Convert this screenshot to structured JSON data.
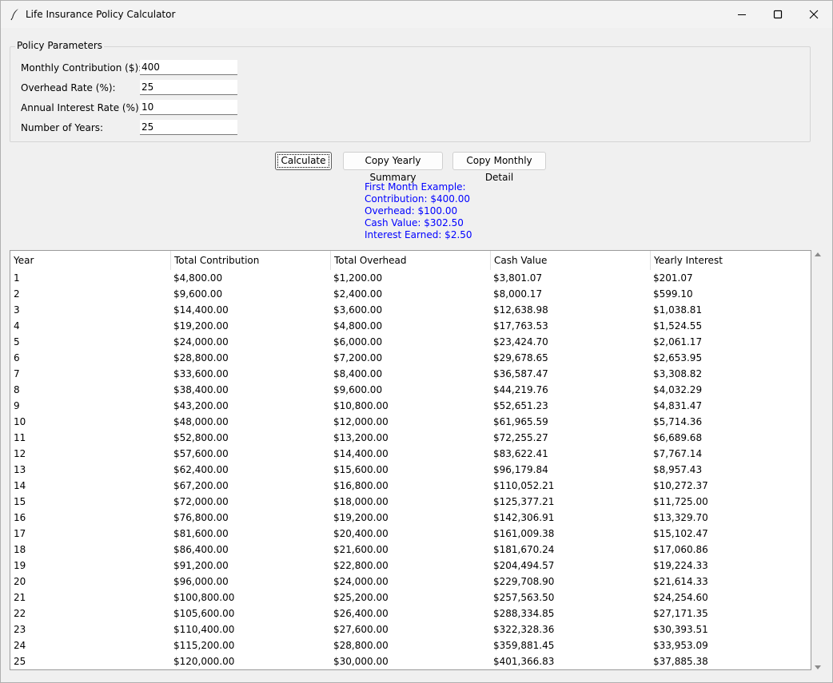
{
  "window": {
    "title": "Life Insurance Policy Calculator",
    "icon": "feather-icon",
    "controls": [
      "minimize-icon",
      "maximize-icon",
      "close-icon"
    ]
  },
  "params": {
    "legend": "Policy Parameters",
    "monthly_contribution": {
      "label": "Monthly Contribution ($):",
      "value": "400"
    },
    "overhead_rate": {
      "label": "Overhead Rate (%):",
      "value": "25"
    },
    "annual_interest_rate": {
      "label": "Annual Interest Rate (%):",
      "value": "10"
    },
    "number_of_years": {
      "label": "Number of Years:",
      "value": "25"
    }
  },
  "buttons": {
    "calculate": "Calculate",
    "copy_yearly": "Copy Yearly Summary",
    "copy_monthly": "Copy Monthly Detail"
  },
  "first_month": {
    "heading": "First Month Example:",
    "contribution": "Contribution: $400.00",
    "overhead": "Overhead: $100.00",
    "cash_value": "Cash Value: $302.50",
    "interest": "Interest Earned: $2.50"
  },
  "colors": {
    "example_text": "#0000ff"
  },
  "table": {
    "columns": [
      "Year",
      "Total Contribution",
      "Total Overhead",
      "Cash Value",
      "Yearly Interest"
    ],
    "rows": [
      [
        "1",
        "$4,800.00",
        "$1,200.00",
        "$3,801.07",
        "$201.07"
      ],
      [
        "2",
        "$9,600.00",
        "$2,400.00",
        "$8,000.17",
        "$599.10"
      ],
      [
        "3",
        "$14,400.00",
        "$3,600.00",
        "$12,638.98",
        "$1,038.81"
      ],
      [
        "4",
        "$19,200.00",
        "$4,800.00",
        "$17,763.53",
        "$1,524.55"
      ],
      [
        "5",
        "$24,000.00",
        "$6,000.00",
        "$23,424.70",
        "$2,061.17"
      ],
      [
        "6",
        "$28,800.00",
        "$7,200.00",
        "$29,678.65",
        "$2,653.95"
      ],
      [
        "7",
        "$33,600.00",
        "$8,400.00",
        "$36,587.47",
        "$3,308.82"
      ],
      [
        "8",
        "$38,400.00",
        "$9,600.00",
        "$44,219.76",
        "$4,032.29"
      ],
      [
        "9",
        "$43,200.00",
        "$10,800.00",
        "$52,651.23",
        "$4,831.47"
      ],
      [
        "10",
        "$48,000.00",
        "$12,000.00",
        "$61,965.59",
        "$5,714.36"
      ],
      [
        "11",
        "$52,800.00",
        "$13,200.00",
        "$72,255.27",
        "$6,689.68"
      ],
      [
        "12",
        "$57,600.00",
        "$14,400.00",
        "$83,622.41",
        "$7,767.14"
      ],
      [
        "13",
        "$62,400.00",
        "$15,600.00",
        "$96,179.84",
        "$8,957.43"
      ],
      [
        "14",
        "$67,200.00",
        "$16,800.00",
        "$110,052.21",
        "$10,272.37"
      ],
      [
        "15",
        "$72,000.00",
        "$18,000.00",
        "$125,377.21",
        "$11,725.00"
      ],
      [
        "16",
        "$76,800.00",
        "$19,200.00",
        "$142,306.91",
        "$13,329.70"
      ],
      [
        "17",
        "$81,600.00",
        "$20,400.00",
        "$161,009.38",
        "$15,102.47"
      ],
      [
        "18",
        "$86,400.00",
        "$21,600.00",
        "$181,670.24",
        "$17,060.86"
      ],
      [
        "19",
        "$91,200.00",
        "$22,800.00",
        "$204,494.57",
        "$19,224.33"
      ],
      [
        "20",
        "$96,000.00",
        "$24,000.00",
        "$229,708.90",
        "$21,614.33"
      ],
      [
        "21",
        "$100,800.00",
        "$25,200.00",
        "$257,563.50",
        "$24,254.60"
      ],
      [
        "22",
        "$105,600.00",
        "$26,400.00",
        "$288,334.85",
        "$27,171.35"
      ],
      [
        "23",
        "$110,400.00",
        "$27,600.00",
        "$322,328.36",
        "$30,393.51"
      ],
      [
        "24",
        "$115,200.00",
        "$28,800.00",
        "$359,881.45",
        "$33,953.09"
      ],
      [
        "25",
        "$120,000.00",
        "$30,000.00",
        "$401,366.83",
        "$37,885.38"
      ]
    ]
  }
}
